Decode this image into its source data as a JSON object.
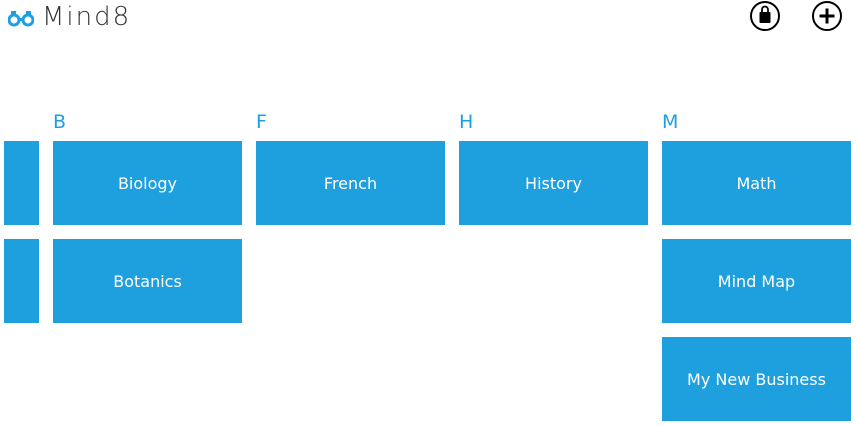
{
  "app": {
    "title": "Mind8",
    "logo_icon": "binoculars-icon",
    "accent_color": "#1e9fde"
  },
  "toolbar": {
    "store_icon": "shopping-bag-icon",
    "add_icon": "plus-circle-icon"
  },
  "groups": [
    {
      "letter": "B",
      "tiles": [
        "Biology",
        "Botanics"
      ]
    },
    {
      "letter": "F",
      "tiles": [
        "French"
      ]
    },
    {
      "letter": "H",
      "tiles": [
        "History"
      ]
    },
    {
      "letter": "M",
      "tiles": [
        "Math",
        "Mind Map",
        "My New Business"
      ]
    }
  ]
}
